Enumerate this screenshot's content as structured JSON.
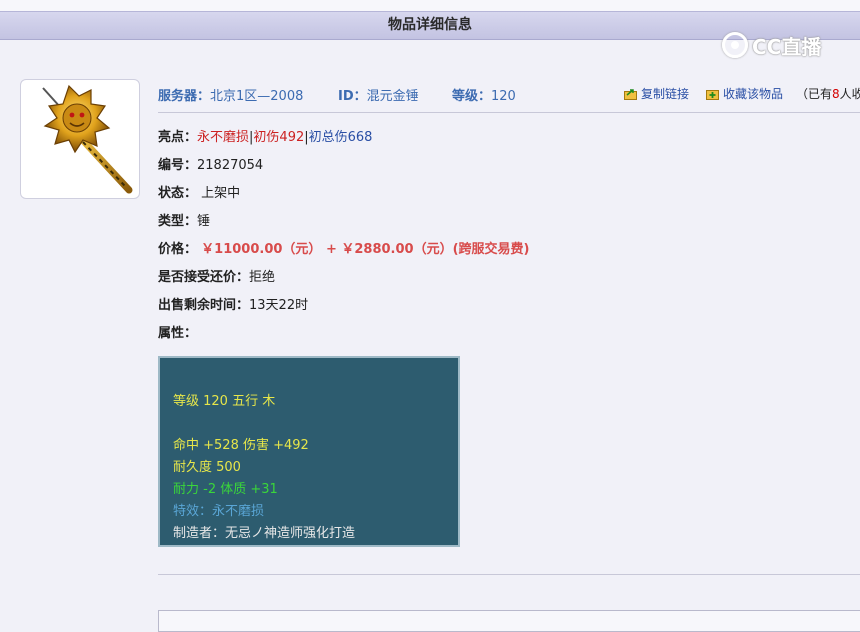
{
  "header": {
    "title": "物品详细信息"
  },
  "watermark": {
    "text": "CC直播"
  },
  "item": {
    "server_label": "服务器：",
    "server_value": "北京1区—2008",
    "id_label": "ID：",
    "id_value": "混元金锤",
    "level_label": "等级：",
    "level_value": "120"
  },
  "actions": {
    "copy_link": "复制链接",
    "favorite": "收藏该物品",
    "fav_prefix": "（已有",
    "fav_count": "8",
    "fav_suffix": "人收藏"
  },
  "details": {
    "highlight_label": "亮点：",
    "highlight_1": "永不磨损",
    "sep1": "|",
    "highlight_2": "初伤492",
    "sep2": "|",
    "highlight_3": "初总伤668",
    "serial_label": "编号：",
    "serial_value": "21827054",
    "status_label": "状态：",
    "status_value": "上架中",
    "type_label": "类型：",
    "type_value": "锤",
    "price_label": "价格：",
    "price_value": "￥11000.00（元） + ￥2880.00（元）(跨服交易费)",
    "bargain_label": "是否接受还价：",
    "bargain_value": "拒绝",
    "time_label": "出售剩余时间：",
    "time_value": "13天22时",
    "attr_label": "属性："
  },
  "attributes": {
    "line1": "等级 120 五行 木",
    "line2": "命中 +528 伤害 +492",
    "line3": "耐久度 500",
    "line4": "耐力 -2 体质 +31",
    "line5": "特效：永不磨损",
    "line6": "制造者：无忌ノ神造师强化打造"
  },
  "colors": {
    "title_bar": "#c3c3e2",
    "label_blue": "#3c6bb1",
    "price_red": "#d84b4b",
    "attr_bg": "#2d5c6f",
    "attr_yellow": "#e6e64a",
    "attr_green": "#3ad63a",
    "attr_blue": "#5aa6d6"
  }
}
